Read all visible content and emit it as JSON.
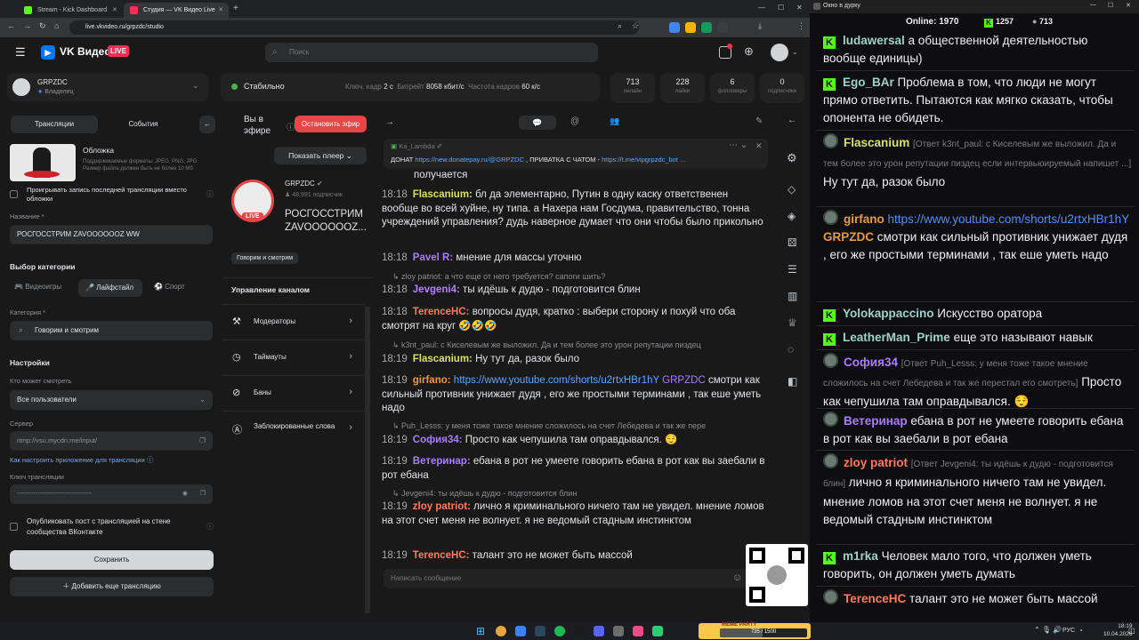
{
  "browser": {
    "tabs": [
      "Stream - Kick Dashboard",
      "Студия — VK Видео Live"
    ],
    "url": "live.vkvideo.ru/grpzdc/studio"
  },
  "vk": {
    "logo_text": "VK Видео",
    "live_badge": "LIVE",
    "search_placeholder": "Поиск",
    "channel_name": "GRPZDC",
    "channel_role": "Владелец",
    "status": "Стабильно",
    "keyframe_label": "Ключ. кадр",
    "keyframe_value": "2 с",
    "bitrate_label": "Битрейт",
    "bitrate_value": "8058 кбит/с",
    "fps_label": "Частота кадров",
    "fps_value": "60 к/с",
    "stats": [
      {
        "n": "713",
        "l": "онлайн"
      },
      {
        "n": "228",
        "l": "лайки"
      },
      {
        "n": "6",
        "l": "фолловеры"
      },
      {
        "n": "0",
        "l": "подписчики"
      }
    ],
    "tab_streams": "Трансляции",
    "tab_events": "События",
    "cover_title": "Обложка",
    "cover_hint": "Поддерживаемые форматы: JPEG, PNG, JPG Размер файла должен быть не более 10 Мб",
    "replay_check": "Проигрывать запись последней трансляции вместо обложки",
    "name_label": "Название *",
    "name_value": "РОСГОССТРИМ ZAVOOOOOOZ WW",
    "category_section": "Выбор категории",
    "cat_tabs": [
      "Видеоигры",
      "Лайфстайл",
      "Спорт"
    ],
    "category_label": "Категория *",
    "category_value": "Говорим и смотрим",
    "settings_title": "Настройки",
    "who_label": "Кто может смотреть",
    "who_value": "Все пользователи",
    "server_label": "Сервер",
    "server_value": "rtmp://vsu.mycdn.me/input/",
    "howto_link": "Как настроить приложение для трансляции",
    "key_label": "Ключ трансляции",
    "key_value": "------------------------------------",
    "publish_check": "Опубликовать пост с трансляцией на стене сообщества ВКонтакте",
    "save_btn": "Сохранить",
    "add_btn": "Добавить еще трансляцию",
    "on_air": "Вы в эфире",
    "stop_btn": "Остановить эфир",
    "show_player": "Показать плеер",
    "preview_channel": "GRPZDC",
    "preview_subs": "48,991 подписчик",
    "preview_title": "РОСГОССТРИМ ZAVOOOOOOZ...",
    "preview_tag": "Говорим и смотрим",
    "preview_live": "LIVE",
    "mgmt_title": "Управление каналом",
    "mgmt_items": [
      "Модераторы",
      "Таймауты",
      "Баны",
      "Заблокированные слова"
    ]
  },
  "chat": {
    "pinned_author": "Ka_Lambda",
    "pinned_text_a": "ДОНАТ ",
    "pinned_link_a": "https://new.donatepay.ru/@GRPZDC",
    "pinned_text_b": " , ПРИВАТКА С ЧАТОМ - ",
    "pinned_link_b": "https://t.me/vipgrpzdc_bot ...",
    "partial": "получается",
    "input_placeholder": "Написать сообщение",
    "messages": [
      {
        "t": "18:18",
        "u": "Flascanium:",
        "text": "бл да элементарно, Путин в одну каску ответственен вообще во всей хуйне, ну типа. а Нахера нам Госдума, правительство, тонна учреждений управления? дудь наверное думает что они чтобы было прикольно"
      },
      {
        "t": "18:18",
        "u": "Pavel R:",
        "text": "мнение для массы уточню"
      },
      {
        "reply": "zloy patriot: а что еще от него требуется? сапоги шить?"
      },
      {
        "t": "18:18",
        "u": "Jevgeni4:",
        "text": "ты идёшь к дудю - подготовится блин"
      },
      {
        "t": "18:18",
        "u": "TerenceHC:",
        "text": "вопросы дудя, кратко : выбери сторону и похуй что оба смотрят на круг 🤣🤣🤣"
      },
      {
        "reply": "k3nt_paul: с Киселевым же выложил. Да и тем более это урон репутации пиздец"
      },
      {
        "t": "18:19",
        "u": "Flascanium:",
        "text": "Ну тут да, разок было"
      },
      {
        "t": "18:19",
        "u": "girfano:",
        "link": "https://www.youtube.com/shorts/u2rtxHBr1hY",
        "mention": "GRPZDC",
        "text": "смотри как сильный противник унижает дудя , его же простыми терминами , так еше уметь надо"
      },
      {
        "reply": "Puh_Lesss: у меня тоже такое мнение сложилось на счет Лебедева и так же пере"
      },
      {
        "t": "18:19",
        "u": "София34:",
        "text": "Просто как чепушила там оправдывался. 😌"
      },
      {
        "t": "18:19",
        "u": "Ветеринар:",
        "text": "ебана в рот не умеете говорить ебана в рот как вы заебали в рот ебана"
      },
      {
        "reply": "Jevgeni4: ты идёшь к дудю - подготовится блин"
      },
      {
        "t": "18:19",
        "u": "zloy patriot:",
        "text": "лично я криминального ничего там не увидел. мнение ломов на этот счет меня не волнует. я не ведомый стадным инстинктом"
      },
      {
        "t": "18:19",
        "u": "TerenceHC:",
        "text": "талант это не может быть массой"
      }
    ]
  },
  "obs": {
    "window_title": "Окно в дурку",
    "online_label": "Online:",
    "online_value": "1970",
    "kick_count": "1257",
    "vk_count": "713",
    "messages": [
      {
        "u": "ludawersal",
        "text": "а общественной деятельностью вообще единицы)"
      },
      {
        "u": "Ego_BAr",
        "text": "Проблема в том, что люди не могут прямо ответить. Пытаются как мягко сказать, чтобы опонента не обидеть."
      },
      {
        "u": "Flascanium",
        "reply": "[Ответ k3nt_paul: с Киселевым же выложил. Да и тем более это урон репутации пиздец если интервьюируемый напишет ...]",
        "text": "Ну тут да, разок было"
      },
      {
        "u": "girfano",
        "link": "https://www.youtube.com/shorts/u2rtxHBr1hY",
        "mention": "GRPZDC",
        "text": "смотри как сильный противник унижает дудя , его же простыми терминами , так еше уметь надо"
      },
      {
        "u": "Yolokappaccino",
        "text": "Искусство оратора"
      },
      {
        "u": "LeatherMan_Prime",
        "text": "еще это называют навык"
      },
      {
        "u": "София34",
        "reply": "[Ответ Puh_Lesss: у меня тоже такое мнение сложилось на счет Лебедева и так же перестал его смотреть]",
        "text": "Просто как чепушила там оправдывался. 😌"
      },
      {
        "u": "Ветеринар",
        "text": "ебана в рот не умеете говорить ебана в рот как вы заебали в рот ебана"
      },
      {
        "u": "zloy patriot",
        "reply": "[Ответ Jevgeni4: ты идёшь к дудю - подготовится блин]",
        "text": "лично я криминального ничего там не увидел. мнение ломов на этот счет меня не волнует. я не ведомый стадным инстинктом"
      },
      {
        "u": "m1rka",
        "text": "Человек мало того, что должен уметь говорить, он должен уметь думать"
      },
      {
        "u": "TerenceHC",
        "text": "талант это не может быть массой"
      }
    ]
  },
  "taskbar": {
    "lang": "РУС",
    "time": "18:19",
    "date": "10.04.2026",
    "meme_label": "MEME PARTY",
    "meme_count": "735 / 1500"
  }
}
